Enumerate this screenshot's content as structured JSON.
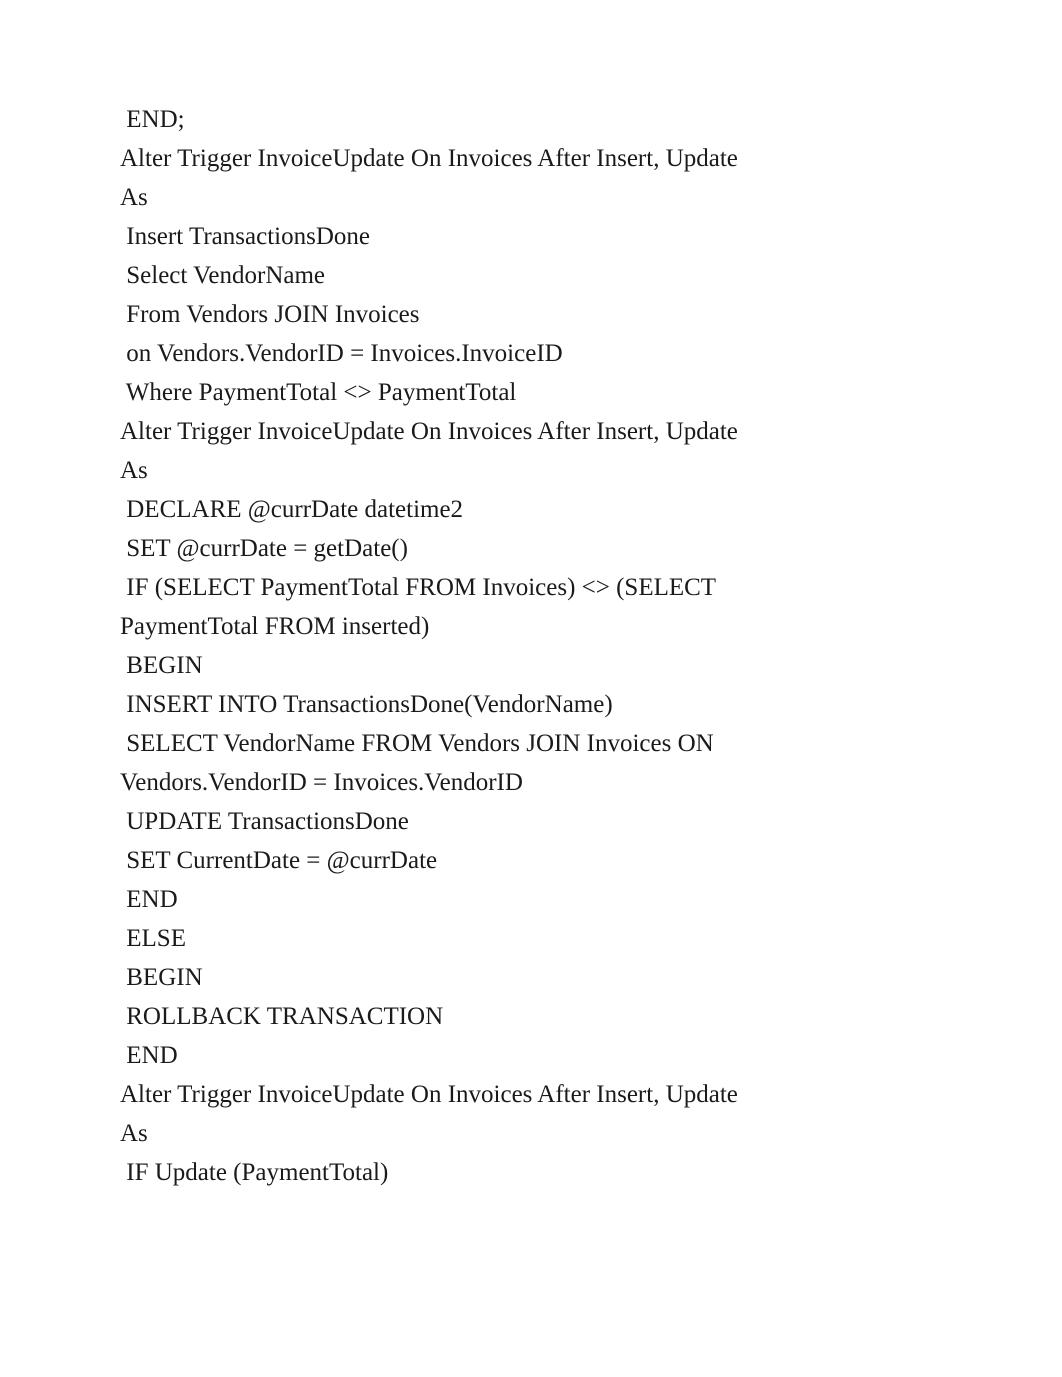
{
  "lines": [
    " END;",
    "Alter Trigger InvoiceUpdate On Invoices After Insert, Update",
    "As",
    " Insert TransactionsDone",
    " Select VendorName",
    " From Vendors JOIN Invoices",
    " on Vendors.VendorID = Invoices.InvoiceID",
    " Where PaymentTotal <> PaymentTotal",
    "Alter Trigger InvoiceUpdate On Invoices After Insert, Update",
    "As",
    " DECLARE @currDate datetime2",
    " SET @currDate = getDate()",
    " IF (SELECT PaymentTotal FROM Invoices) <> (SELECT",
    "PaymentTotal FROM inserted)",
    " BEGIN",
    " INSERT INTO TransactionsDone(VendorName)",
    " SELECT VendorName FROM Vendors JOIN Invoices ON",
    "Vendors.VendorID = Invoices.VendorID",
    " UPDATE TransactionsDone",
    " SET CurrentDate = @currDate",
    " END",
    " ELSE",
    " BEGIN",
    " ROLLBACK TRANSACTION",
    " END",
    "Alter Trigger InvoiceUpdate On Invoices After Insert, Update",
    "As",
    " IF Update (PaymentTotal)"
  ]
}
